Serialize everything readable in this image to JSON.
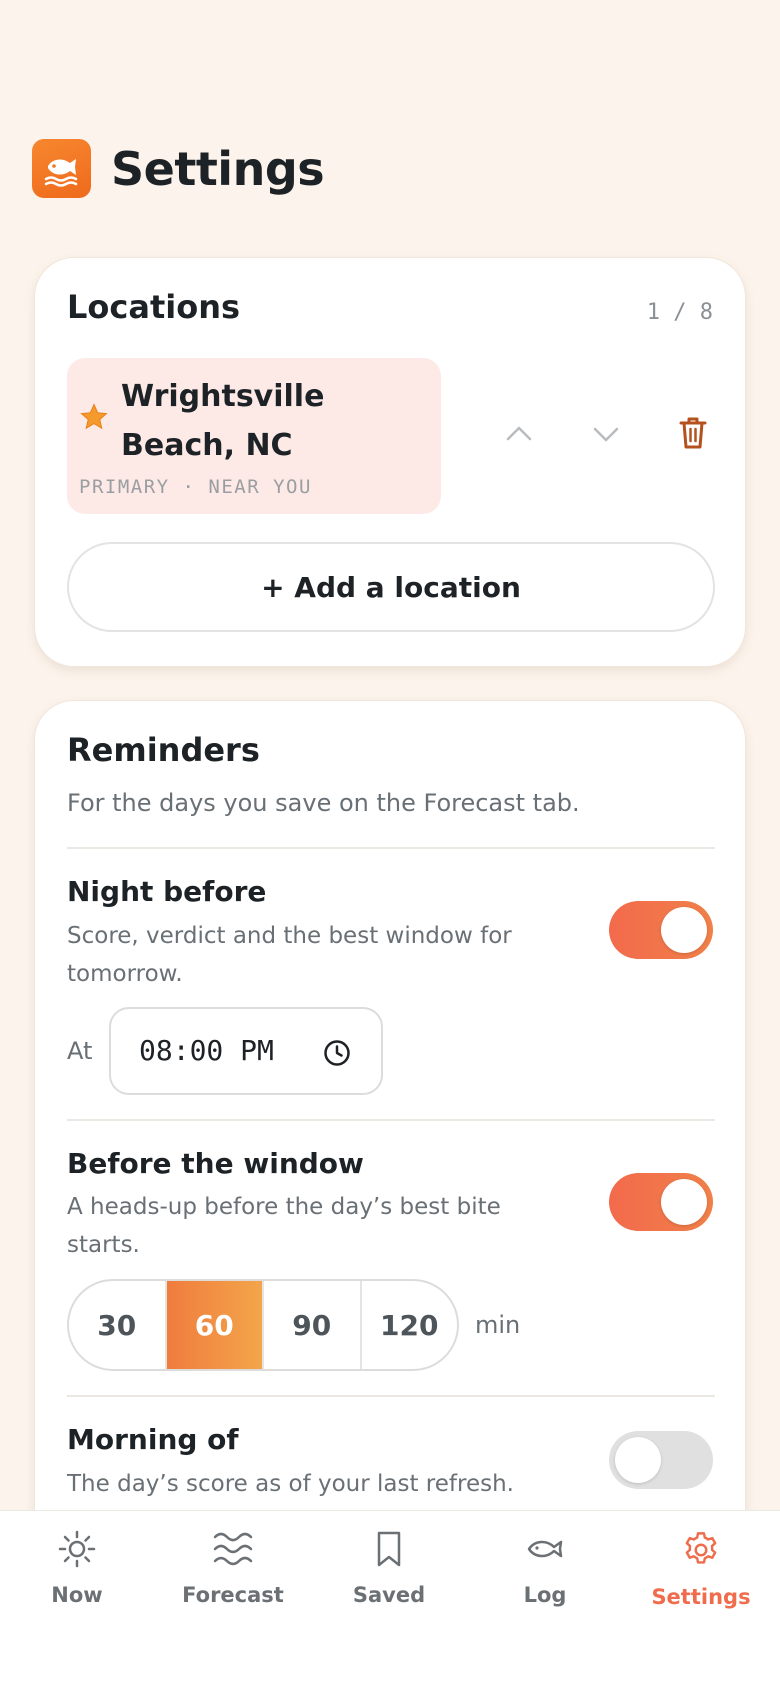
{
  "header": {
    "title": "Settings",
    "logo_icon": "fish-icon"
  },
  "locations": {
    "title": "Locations",
    "count": "1 / 8",
    "items": [
      {
        "name": "Wrightsville Beach, NC",
        "meta": "PRIMARY · NEAR YOU",
        "primary": true
      }
    ],
    "add_label": "+ Add a location"
  },
  "reminders": {
    "title": "Reminders",
    "subtitle": "For the days you save on the Forecast tab.",
    "night_before": {
      "title": "Night before",
      "desc": "Score, verdict and the best window for tomorrow.",
      "enabled": true,
      "at_label": "At",
      "time": "08:00 PM"
    },
    "before_window": {
      "title": "Before the window",
      "desc": "A heads-up before the day’s best bite starts.",
      "enabled": true,
      "options": [
        "30",
        "60",
        "90",
        "120"
      ],
      "selected": "60",
      "unit": "min"
    },
    "morning_of": {
      "title": "Morning of",
      "desc": "The day’s score as of your last refresh.",
      "enabled": false
    }
  },
  "tabbar": {
    "tabs": [
      {
        "label": "Now",
        "icon": "sun-icon"
      },
      {
        "label": "Forecast",
        "icon": "waves-icon"
      },
      {
        "label": "Saved",
        "icon": "bookmark-icon"
      },
      {
        "label": "Log",
        "icon": "fish-icon"
      },
      {
        "label": "Settings",
        "icon": "gear-icon",
        "active": true
      }
    ]
  },
  "colors": {
    "background": "#fcf4ec",
    "accent": "#ef6c4c",
    "toggle_on": "#f36a4d",
    "primary_location_bg": "#fdeae6"
  }
}
